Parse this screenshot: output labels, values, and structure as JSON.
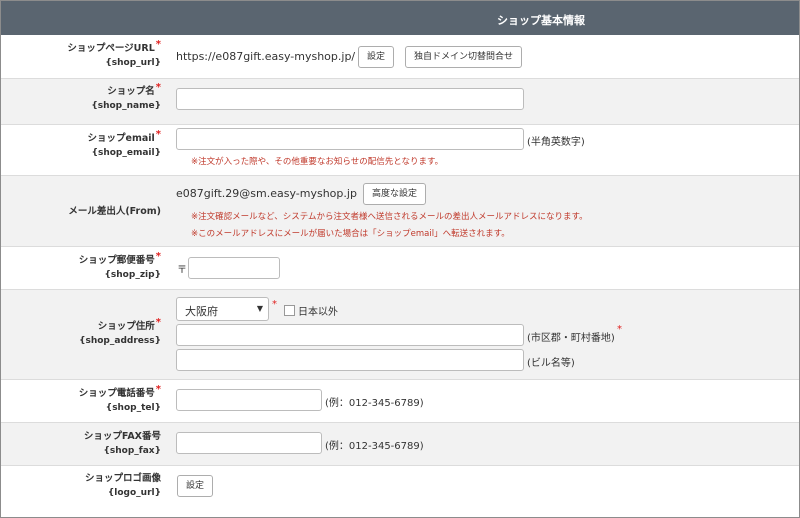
{
  "header": {
    "title": "ショップ基本情報"
  },
  "required_mark": "*",
  "rows": {
    "shop_url": {
      "label": "ショップページURL",
      "key": "{shop_url}",
      "value": "https://e087gift.easy-myshop.jp/",
      "set_button": "設定",
      "domain_button": "独自ドメイン切替問合せ"
    },
    "shop_name": {
      "label": "ショップ名",
      "key": "{shop_name}",
      "value": ""
    },
    "shop_email": {
      "label": "ショップemail",
      "key": "{shop_email}",
      "value": "",
      "hint": "(半角英数字)",
      "note": "※注文が入った際や、その他重要なお知らせの配信先となります。"
    },
    "from": {
      "label": "メール差出人(From)",
      "value": "e087gift.29@sm.easy-myshop.jp",
      "button": "高度な設定",
      "note1": "※注文確認メールなど、システムから注文者様へ送信されるメールの差出人メールアドレスになります。",
      "note2": "※このメールアドレスにメールが届いた場合は「ショップemail」へ転送されます。"
    },
    "shop_zip": {
      "label": "ショップ郵便番号",
      "key": "{shop_zip}",
      "prefix": "〒",
      "value": ""
    },
    "shop_address": {
      "label": "ショップ住所",
      "key": "{shop_address}",
      "prefecture": "大阪府",
      "overseas_label": "日本以外",
      "address1_hint": "(市区郡・町村番地)",
      "address2_hint": "(ビル名等)"
    },
    "shop_tel": {
      "label": "ショップ電話番号",
      "key": "{shop_tel}",
      "hint": "(例：012-345-6789)"
    },
    "shop_fax": {
      "label": "ショップFAX番号",
      "key": "{shop_fax}",
      "hint": "(例：012-345-6789)"
    },
    "logo_url": {
      "label": "ショップロゴ画像",
      "key": "{logo_url}",
      "button": "設定"
    }
  },
  "colors": {
    "header_bg": "#5a6570",
    "required": "#e0201f",
    "note": "#c0392b",
    "row_alt": "#f2f2f2"
  }
}
